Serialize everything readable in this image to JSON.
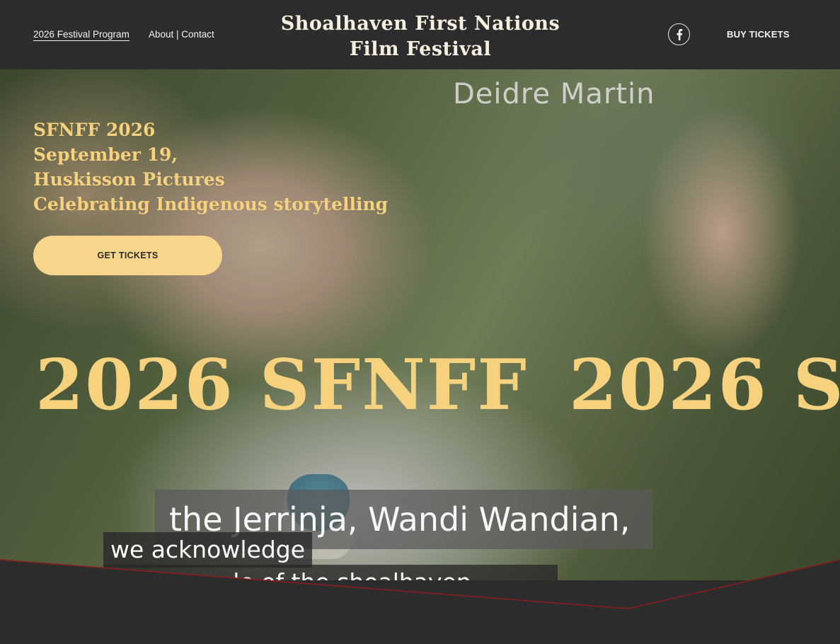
{
  "header": {
    "nav_program": "2026 Festival Program",
    "nav_about": "About | Contact",
    "title_line1": "Shoalhaven First Nations",
    "title_line2": "Film Festival",
    "social_icon": "facebook-icon",
    "buy_label": "BUY TICKETS"
  },
  "hero": {
    "video_name_caption": "Deidre Martin",
    "lines": [
      "SFNFF 2026",
      "September 19,",
      "Huskisson Pictures",
      "Celebrating Indigenous storytelling"
    ],
    "cta_label": "GET TICKETS",
    "marquee_text": "2026 SFNFF",
    "subtitle_line1": "the Jerrinja, Wandi Wandian,",
    "subtitle_line2": "we acknowledge",
    "subtitle_line3": "ginal people of the shoalhaven"
  },
  "colors": {
    "background": "#2c2c2d",
    "accent_gold": "#f7d27e",
    "cta_fill": "#f7d58a",
    "divider_line": "#8c1c1c"
  }
}
